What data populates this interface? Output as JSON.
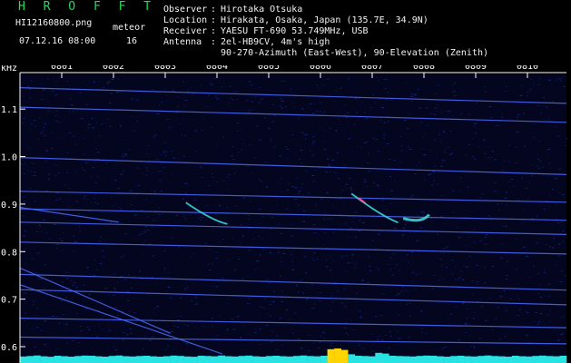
{
  "header": {
    "brand": "H R O F F T",
    "filename": "HI12160800.png",
    "meteor_label": "meteor",
    "datetime": "07.12.16 08:00",
    "meteor_count": "16",
    "info": [
      {
        "key": "Observer",
        "value": "Hirotaka Otsuka"
      },
      {
        "key": "Location",
        "value": "Hirakata, Osaka, Japan (135.7E, 34.9N)"
      },
      {
        "key": "Receiver",
        "value": "YAESU FT-690 53.749MHz, USB"
      },
      {
        "key": "Antenna",
        "value": "2el-HB9CV, 4m's high"
      }
    ],
    "antenna_extra": "90-270-Azimuth (East-West), 90-Elevation (Zenith)"
  },
  "chart_data": {
    "type": "heatmap",
    "title": "",
    "xlabel": "",
    "ylabel": "kHz",
    "x_ticks": [
      "0801",
      "0802",
      "0803",
      "0804",
      "0805",
      "0806",
      "0807",
      "0808",
      "0809",
      "0810"
    ],
    "y_ticks": [
      "1.1",
      "1.0",
      "0.9",
      "0.8",
      "0.7",
      "0.6"
    ],
    "ylim": [
      0.6,
      1.15
    ],
    "colors": {
      "background": "#03061e",
      "noise": "#1c2a9c",
      "line": "#4b6bff",
      "meteor": "#3fd3d6",
      "meteor_hot": "#ff4fa0",
      "activity": "#29e3e3",
      "activity_hot": "#ffd400",
      "axis": "#ffffff"
    },
    "carriers": [
      {
        "name": "c1",
        "y0": 1.145,
        "y1": 1.112
      },
      {
        "name": "c2",
        "y0": 1.104,
        "y1": 1.072
      },
      {
        "name": "c3",
        "y0": 0.998,
        "y1": 0.962
      },
      {
        "name": "c4",
        "y0": 0.927,
        "y1": 0.904
      },
      {
        "name": "c5",
        "y0": 0.89,
        "y1": 0.866
      },
      {
        "name": "c6",
        "y0": 0.862,
        "y1": 0.836
      },
      {
        "name": "c7",
        "y0": 0.82,
        "y1": 0.795
      },
      {
        "name": "c8",
        "y0": 0.752,
        "y1": 0.719
      },
      {
        "name": "c9",
        "y0": 0.72,
        "y1": 0.688
      },
      {
        "name": "c10",
        "y0": 0.66,
        "y1": 0.64
      },
      {
        "name": "c11",
        "y0": 0.62,
        "y1": 0.606
      }
    ],
    "drifting_traces": [
      {
        "name": "d1",
        "x0": 0.0,
        "y0": 0.893,
        "x1": 1.1,
        "y1": 0.862
      },
      {
        "name": "d2",
        "x0": 0.0,
        "y0": 0.765,
        "x1": 2.1,
        "y1": 0.628
      },
      {
        "name": "d3",
        "x0": 0.0,
        "y0": 0.73,
        "x1": 3.1,
        "y1": 0.585
      }
    ],
    "meteors": [
      {
        "name": "m1",
        "x0": 2.4,
        "y0": 0.903,
        "x1": 3.2,
        "y1": 0.858
      },
      {
        "name": "m2",
        "x0": 5.6,
        "y0": 0.922,
        "x1": 6.5,
        "y1": 0.861
      },
      {
        "name": "m3",
        "x0": 6.6,
        "y0": 0.87,
        "x1": 7.1,
        "y1": 0.878
      }
    ],
    "activity": [
      0.45,
      0.48,
      0.52,
      0.46,
      0.43,
      0.5,
      0.47,
      0.44,
      0.48,
      0.51,
      0.5,
      0.46,
      0.44,
      0.49,
      0.52,
      0.47,
      0.45,
      0.48,
      0.5,
      0.46,
      0.44,
      0.47,
      0.51,
      0.49,
      0.45,
      0.43,
      0.5,
      0.48,
      0.46,
      0.52,
      0.47,
      0.45,
      0.49,
      0.51,
      0.46,
      0.44,
      0.48,
      0.5,
      0.47,
      0.45,
      0.49,
      0.52,
      0.48,
      0.46,
      0.5,
      0.95,
      1.0,
      0.9,
      0.6,
      0.5,
      0.48,
      0.46,
      0.7,
      0.65,
      0.5,
      0.48,
      0.47,
      0.45,
      0.49,
      0.51,
      0.5,
      0.46,
      0.44,
      0.48,
      0.5,
      0.47,
      0.45,
      0.49,
      0.52,
      0.48,
      0.46,
      0.44,
      0.5,
      0.47,
      0.45,
      0.49,
      0.51,
      0.48,
      0.46,
      0.5
    ]
  }
}
